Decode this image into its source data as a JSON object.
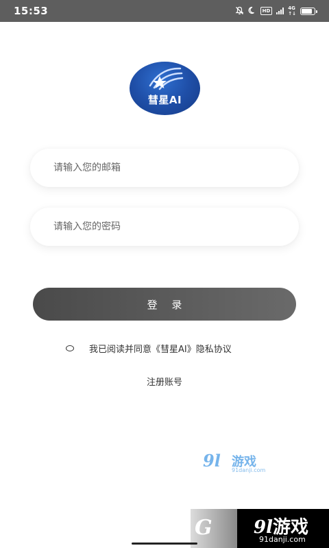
{
  "status_bar": {
    "time": "15:53",
    "icons": [
      "mute-bell-icon",
      "moon-icon",
      "hd-icon",
      "signal-icon",
      "battery-icon"
    ],
    "hd_label": "HD",
    "network_label_top": "4G",
    "network_label_bottom": "↑↓"
  },
  "logo": {
    "text": "彗星AI",
    "icon": "comet-star-icon",
    "color": "#1f4fa8"
  },
  "form": {
    "email_placeholder": "请输入您的邮箱",
    "email_value": "",
    "password_placeholder": "请输入您的密码",
    "password_value": ""
  },
  "login_button": {
    "label": "登 录",
    "color": "#555555"
  },
  "agreement": {
    "checked": false,
    "text": "我已阅读并同意《彗星AI》隐私协议"
  },
  "register_link": "注册账号",
  "watermark": {
    "brand_num": "9l",
    "brand_cn": "游戏",
    "url": "91danji.com"
  },
  "bottom_banner": {
    "left_glyph": "G",
    "brand_num": "9l",
    "brand_cn": "游戏",
    "url": "91danji.com"
  }
}
